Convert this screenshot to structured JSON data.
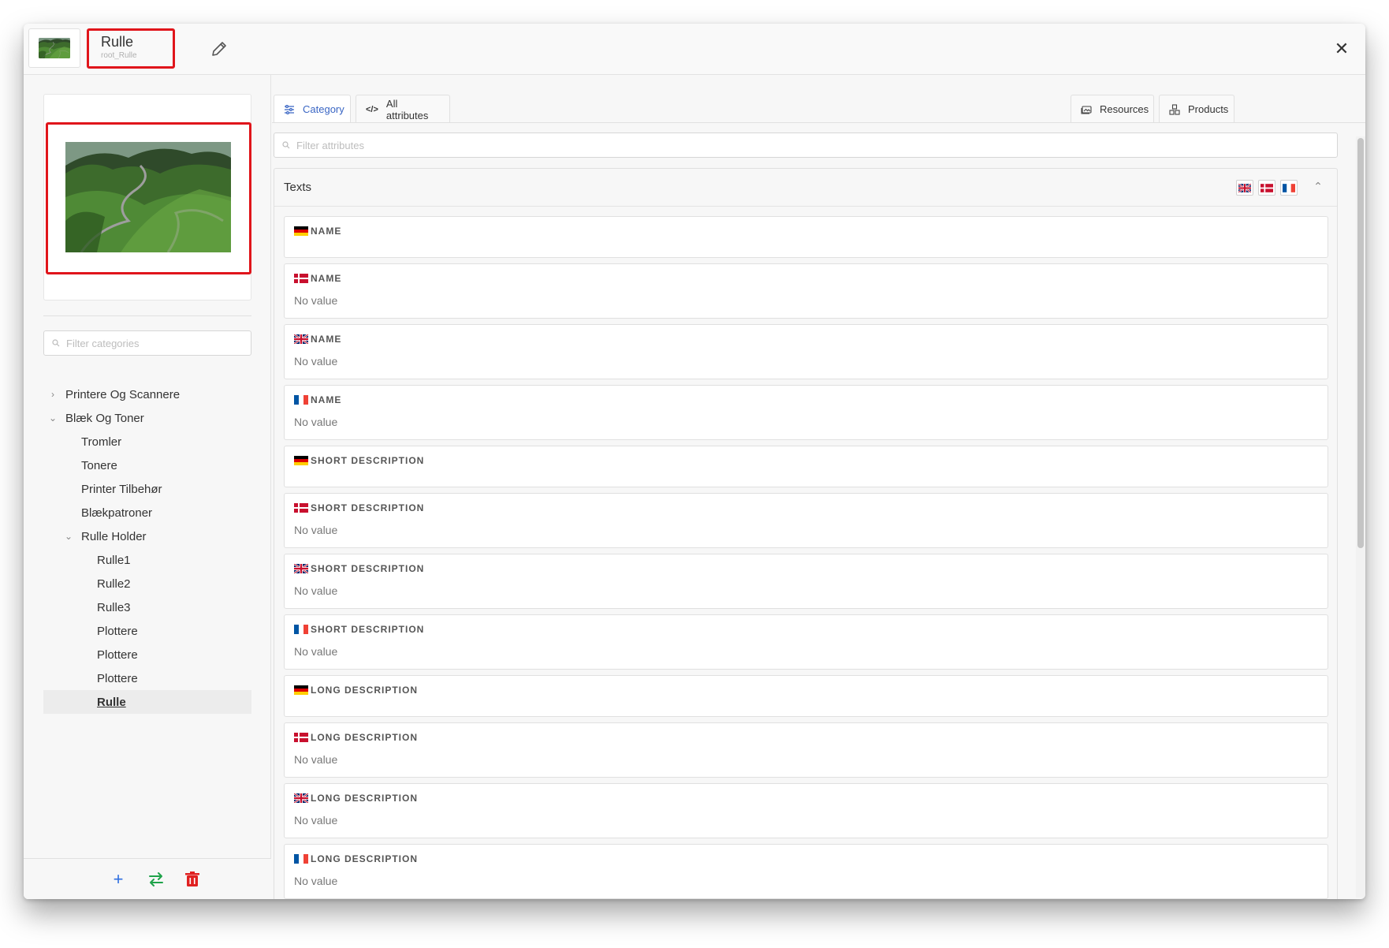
{
  "header": {
    "title": "Rulle",
    "subtitle": "root_Rulle"
  },
  "left": {
    "filter_placeholder": "Filter categories",
    "tree": [
      {
        "label": "Printere Og Scannere",
        "level": 0,
        "chevron": "right"
      },
      {
        "label": "Blæk Og Toner",
        "level": 0,
        "chevron": "down"
      },
      {
        "label": "Tromler",
        "level": 1
      },
      {
        "label": "Tonere",
        "level": 1
      },
      {
        "label": "Printer Tilbehør",
        "level": 1
      },
      {
        "label": "Blækpatroner",
        "level": 1
      },
      {
        "label": "Rulle Holder",
        "level": 1,
        "chevron": "down"
      },
      {
        "label": "Rulle1",
        "level": 2
      },
      {
        "label": "Rulle2",
        "level": 2
      },
      {
        "label": "Rulle3",
        "level": 2
      },
      {
        "label": "Plottere",
        "level": 2
      },
      {
        "label": "Plottere",
        "level": 2
      },
      {
        "label": "Plottere",
        "level": 2
      },
      {
        "label": "Rulle",
        "level": 2,
        "selected": true
      }
    ],
    "footer": {
      "add_icon": "plus-icon",
      "move_icon": "swap-arrows-icon",
      "delete_icon": "trash-icon",
      "colors": {
        "add": "#2f6fe0",
        "move": "#1fa34a",
        "delete": "#e02020"
      }
    }
  },
  "tabs": {
    "category": "Category",
    "all_attributes": "All attributes",
    "resources": "Resources",
    "products": "Products"
  },
  "attr_filter_placeholder": "Filter attributes",
  "section": {
    "title": "Texts",
    "languages": [
      "gb",
      "dk",
      "fr"
    ]
  },
  "fields": [
    {
      "flag": "de",
      "label": "NAME",
      "value": ""
    },
    {
      "flag": "dk",
      "label": "NAME",
      "value": "No value"
    },
    {
      "flag": "gb",
      "label": "NAME",
      "value": "No value"
    },
    {
      "flag": "fr",
      "label": "NAME",
      "value": "No value"
    },
    {
      "flag": "de",
      "label": "SHORT DESCRIPTION",
      "value": ""
    },
    {
      "flag": "dk",
      "label": "SHORT DESCRIPTION",
      "value": "No value"
    },
    {
      "flag": "gb",
      "label": "SHORT DESCRIPTION",
      "value": "No value"
    },
    {
      "flag": "fr",
      "label": "SHORT DESCRIPTION",
      "value": "No value"
    },
    {
      "flag": "de",
      "label": "LONG DESCRIPTION",
      "value": ""
    },
    {
      "flag": "dk",
      "label": "LONG DESCRIPTION",
      "value": "No value"
    },
    {
      "flag": "gb",
      "label": "LONG DESCRIPTION",
      "value": "No value"
    },
    {
      "flag": "fr",
      "label": "LONG DESCRIPTION",
      "value": "No value"
    }
  ],
  "colors": {
    "accent": "#3a66c4",
    "highlight_border": "#e0151b"
  }
}
